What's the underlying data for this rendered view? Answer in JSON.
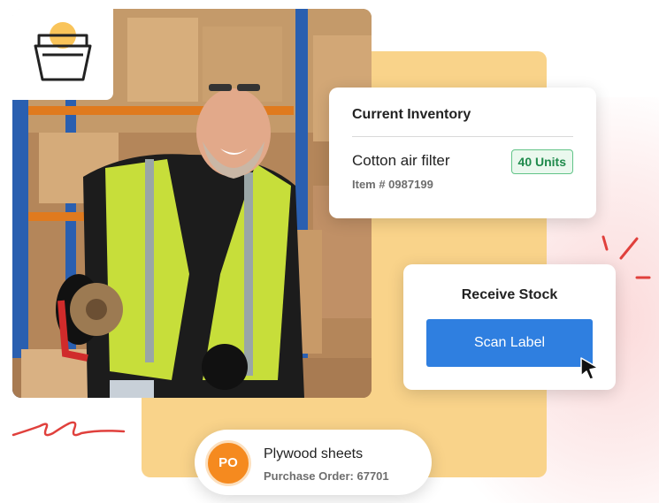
{
  "inventory_card": {
    "title": "Current Inventory",
    "item_name": "Cotton air filter",
    "item_number": "Item # 0987199",
    "quantity_badge": "40 Units"
  },
  "receive_card": {
    "title": "Receive Stock",
    "scan_button_label": "Scan Label"
  },
  "purchase_order_card": {
    "avatar_initials": "PO",
    "item_name": "Plywood sheets",
    "order_text": "Purchase Order: 67701"
  },
  "icons": {
    "logo": "shopping-basket-icon",
    "cursor": "mouse-pointer-icon"
  },
  "colors": {
    "amber_panel": "#f9d38a",
    "primary_button": "#2f7fe0",
    "badge_green": "#1f8a4c",
    "avatar_orange": "#f58a1f",
    "accent_red": "#e0403c"
  }
}
